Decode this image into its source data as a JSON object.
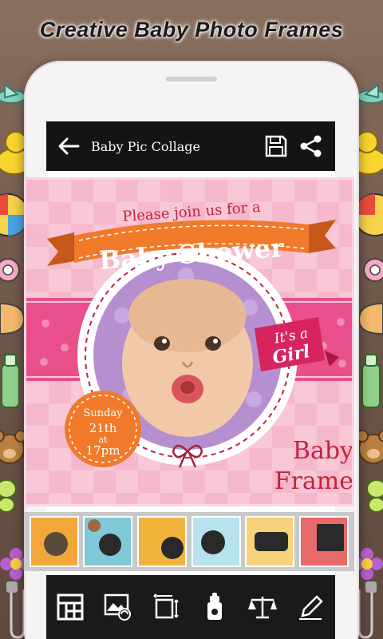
{
  "headline": "Creative Baby Photo Frames",
  "appbar": {
    "title": "Baby Pic Collage",
    "back_icon": "arrow-left-icon",
    "save_icon": "save-icon",
    "share_icon": "share-icon"
  },
  "frame": {
    "invite_text": "Please join us for a",
    "banner_text": "Baby Shower",
    "tag_line1": "It's a",
    "tag_line2": "Girl",
    "date_day": "Sunday",
    "date_num": "21th",
    "date_at": "at",
    "date_time": "17pm",
    "caption_line1": "Baby",
    "caption_line2": "Frame"
  },
  "thumbnails": [
    {
      "name": "frame-thumb-1",
      "color": "#f3a73a"
    },
    {
      "name": "frame-thumb-2",
      "color": "#7fc8d8"
    },
    {
      "name": "frame-thumb-3",
      "color": "#f2b33d"
    },
    {
      "name": "frame-thumb-4",
      "color": "#b7e3ef"
    },
    {
      "name": "frame-thumb-5",
      "color": "#f6d27a"
    },
    {
      "name": "frame-thumb-6",
      "color": "#e86a6a"
    }
  ],
  "toolbar": [
    {
      "name": "layout-tool",
      "icon": "grid-layout-icon"
    },
    {
      "name": "change-photo-tool",
      "icon": "image-swap-icon"
    },
    {
      "name": "resize-tool",
      "icon": "resize-icon"
    },
    {
      "name": "sticker-tool",
      "icon": "baby-bottle-icon"
    },
    {
      "name": "adjust-tool",
      "icon": "balance-icon"
    },
    {
      "name": "text-tool",
      "icon": "pen-icon"
    }
  ],
  "colors": {
    "appbar_bg": "#141414",
    "frame_pink": "#f6b8cc",
    "banner_orange": "#f07a2a",
    "accent_red": "#c2233e",
    "photo_bg": "#b58fd0"
  }
}
